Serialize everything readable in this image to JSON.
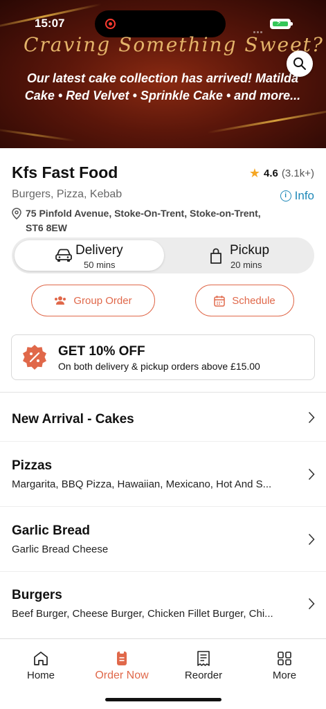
{
  "status_bar": {
    "time": "15:07"
  },
  "banner": {
    "script_headline": "Craving Something Sweet?",
    "message": "Our latest cake collection has arrived! Matilda Cake • Red Velvet • Sprinkle Cake • and more...",
    "search_icon": "search-icon"
  },
  "restaurant": {
    "name": "Kfs Fast Food",
    "rating": "4.6",
    "rating_count": "(3.1k+)",
    "cuisines": "Burgers, Pizza, Kebab",
    "info_label": "Info",
    "address": "75 Pinfold Avenue, Stoke-On-Trent, Stoke-on-Trent, ST6 8EW"
  },
  "order_mode": {
    "delivery": {
      "label": "Delivery",
      "time": "50 mins",
      "selected": true
    },
    "pickup": {
      "label": "Pickup",
      "time": "20 mins",
      "selected": false
    }
  },
  "actions": {
    "group_order": "Group Order",
    "schedule": "Schedule"
  },
  "promo": {
    "title": "GET 10% OFF",
    "subtitle": "On both delivery & pickup orders above £15.00"
  },
  "categories": [
    {
      "title": "New Arrival - Cakes",
      "items": ""
    },
    {
      "title": "Pizzas",
      "items": "Margarita, BBQ Pizza, Hawaiian, Mexicano, Hot And S..."
    },
    {
      "title": "Garlic Bread",
      "items": "Garlic Bread Cheese"
    },
    {
      "title": "Burgers",
      "items": "Beef Burger, Cheese Burger, Chicken Fillet Burger, Chi..."
    }
  ],
  "bottom_nav": [
    {
      "label": "Home",
      "icon": "home-icon"
    },
    {
      "label": "Order Now",
      "icon": "order-icon",
      "active": true
    },
    {
      "label": "Reorder",
      "icon": "receipt-icon"
    },
    {
      "label": "More",
      "icon": "grid-icon"
    }
  ],
  "colors": {
    "accent": "#e0684a",
    "link": "#1e88b8",
    "star": "#f5a623"
  }
}
